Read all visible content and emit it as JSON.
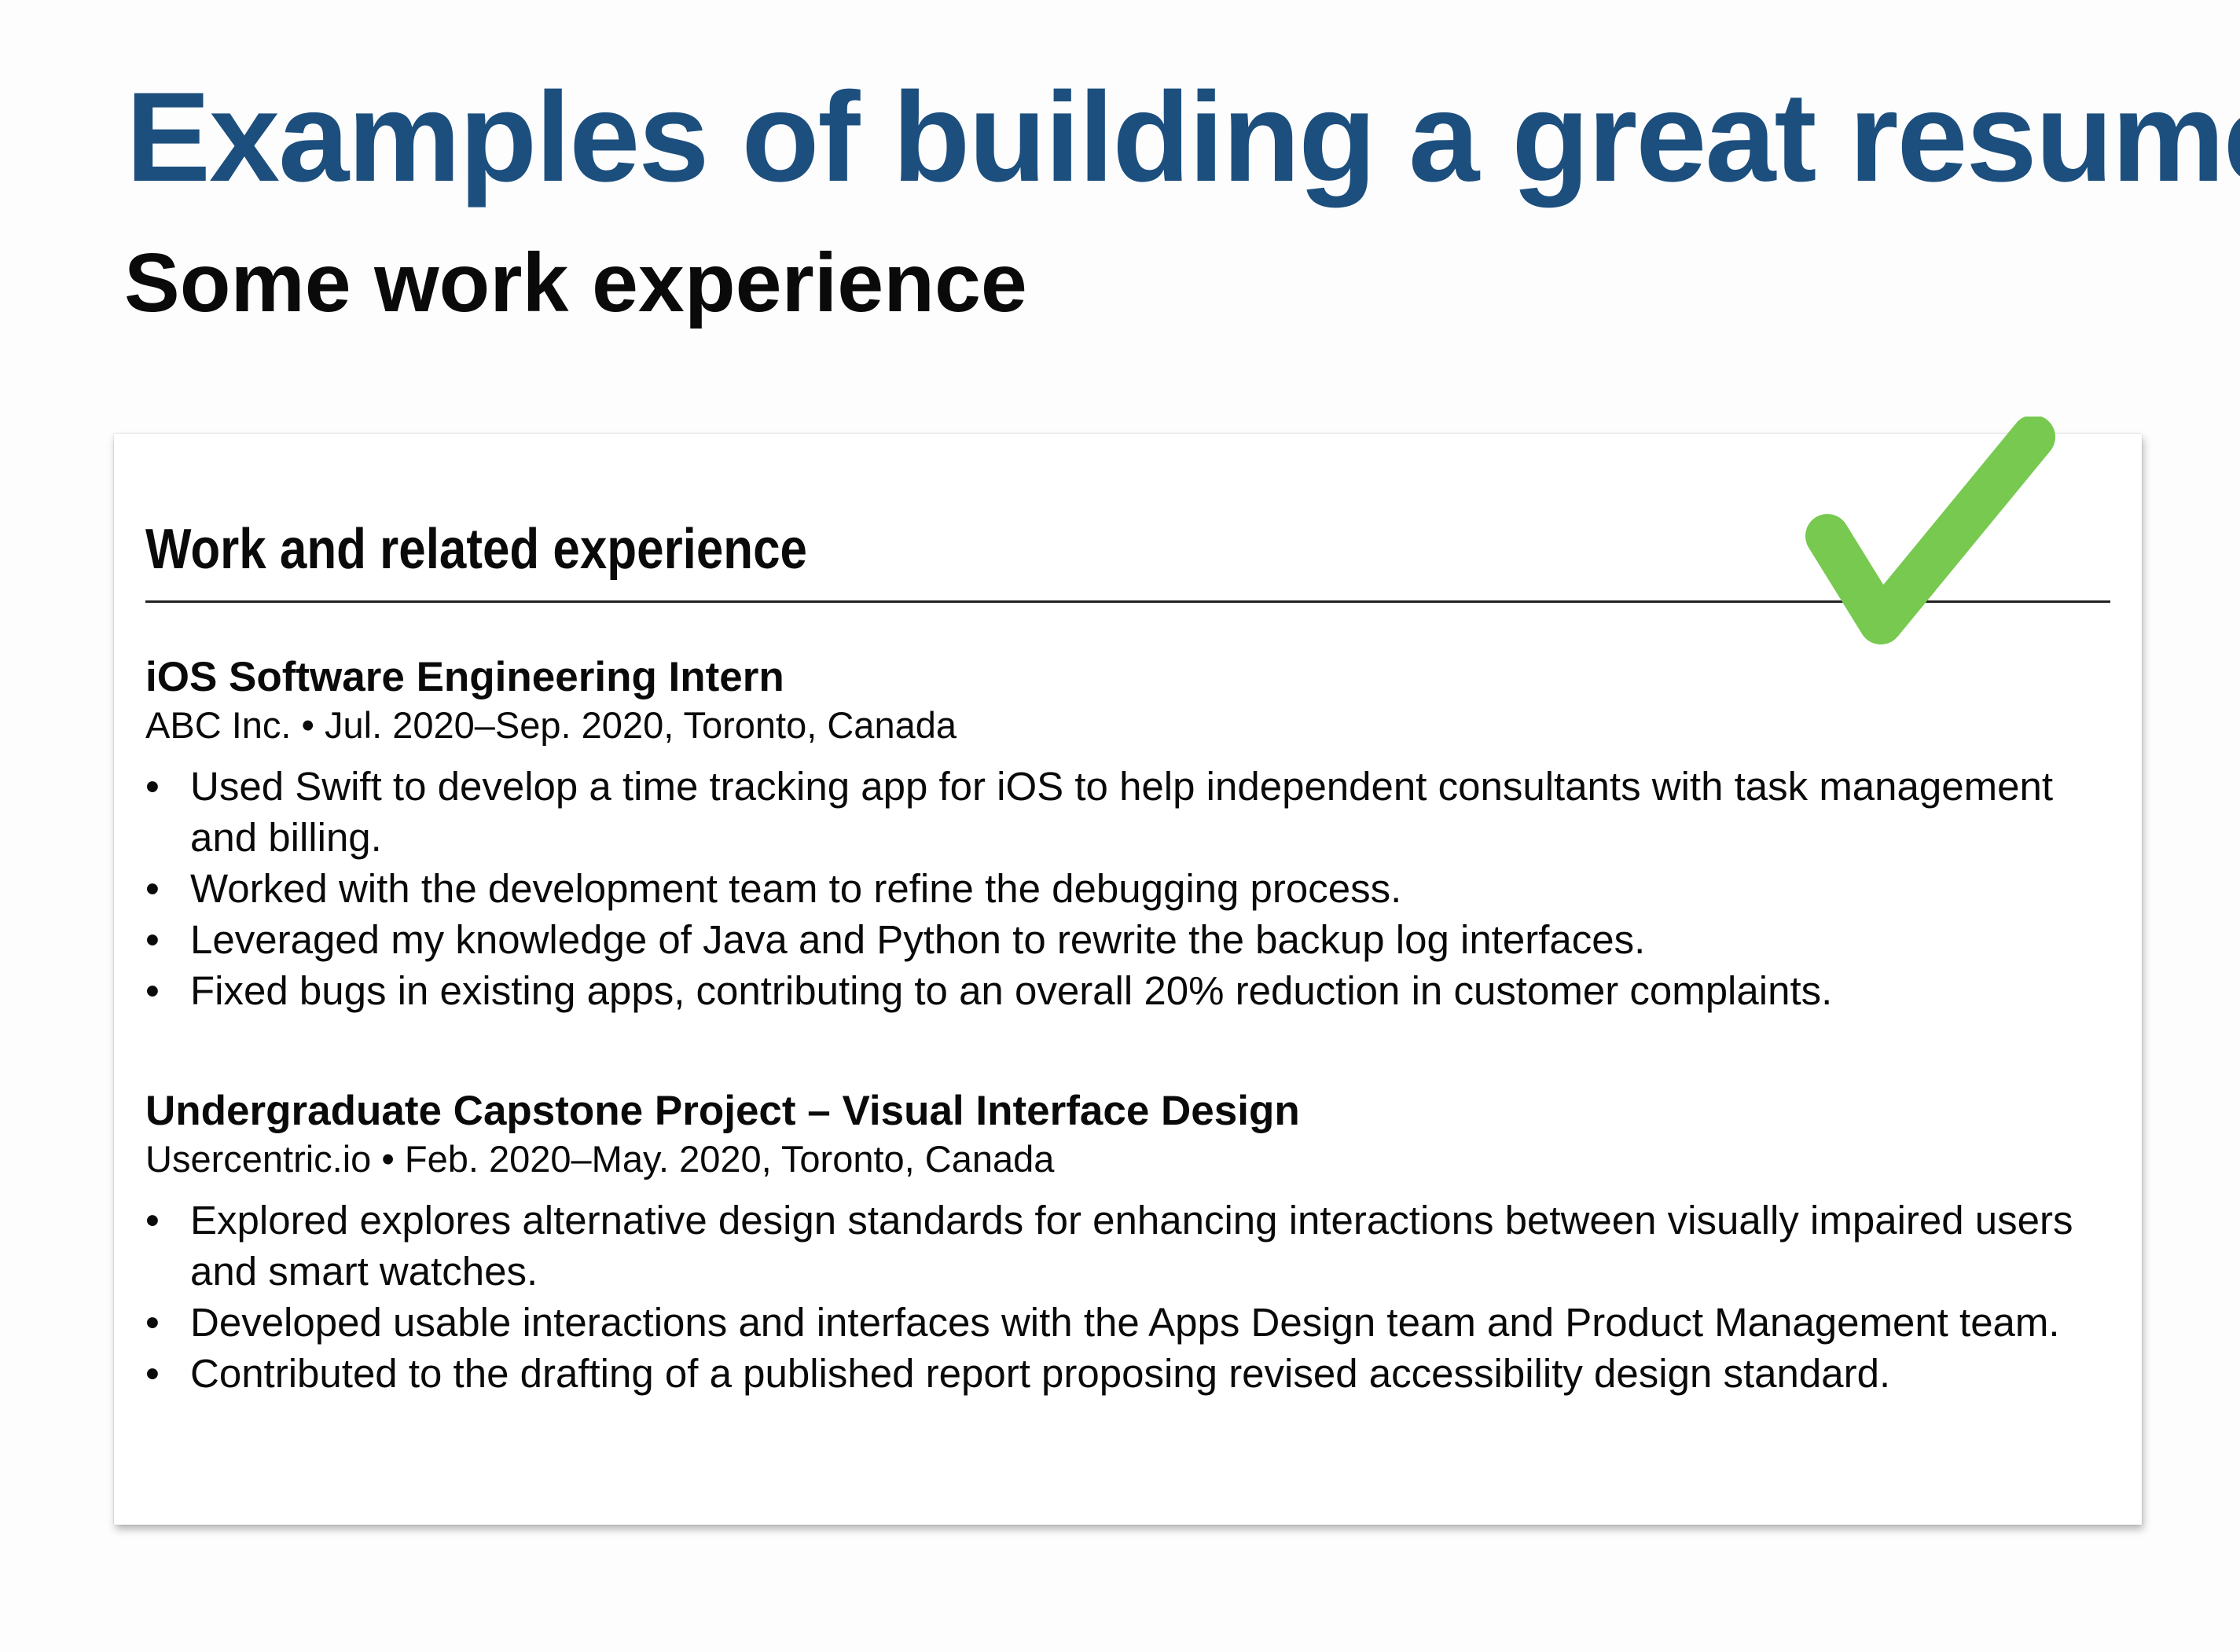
{
  "slide": {
    "title": "Examples of building a great resume",
    "subtitle": "Some work experience"
  },
  "colors": {
    "title": "#1c4f7e",
    "checkmark": "#77c94f",
    "text": "#0a0a0a"
  },
  "resume": {
    "section_heading": "Work and related experience",
    "badge_icon": "checkmark-icon",
    "entries": [
      {
        "title": "iOS Software Engineering Intern",
        "meta": "ABC Inc. • Jul. 2020–Sep. 2020, Toronto, Canada",
        "bullets": [
          "Used Swift to develop a time tracking app for iOS to help independent consultants with task management and billing.",
          "Worked with the development team to refine the debugging process.",
          "Leveraged my knowledge of Java and Python to rewrite the backup log interfaces.",
          "Fixed bugs in existing apps, contributing to an overall 20% reduction in customer complaints."
        ]
      },
      {
        "title": "Undergraduate Capstone Project – Visual Interface Design",
        "meta": "Usercentric.io • Feb. 2020–May. 2020, Toronto, Canada",
        "bullets": [
          "Explored explores alternative design standards for enhancing interactions between visually impaired users and smart watches.",
          "Developed usable interactions and interfaces with the Apps Design team and Product Management team.",
          "Contributed to the drafting of a published report proposing revised accessibility design standard."
        ]
      }
    ]
  }
}
